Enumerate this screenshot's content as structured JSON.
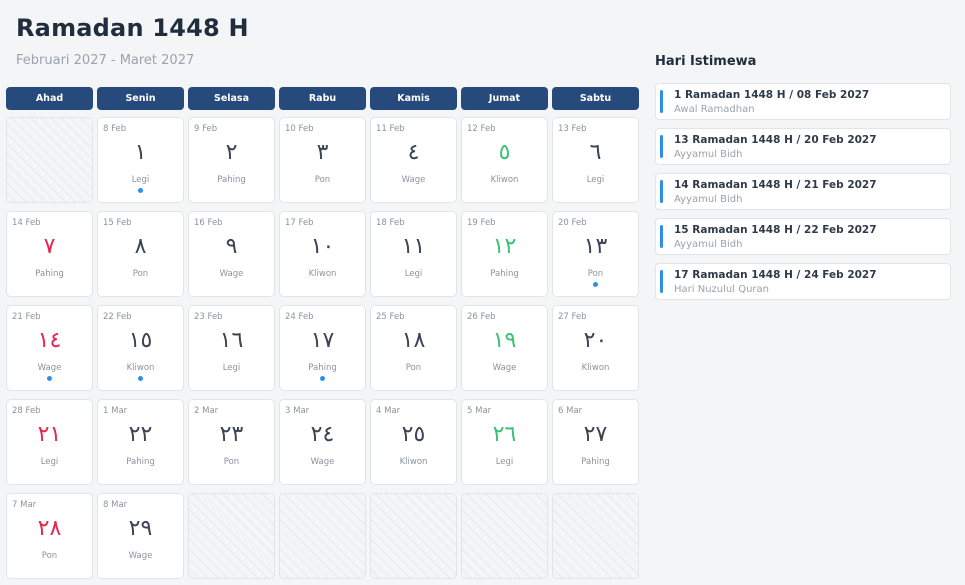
{
  "header": {
    "title": "Ramadan 1448 H",
    "subtitle": "Februari 2027 - Maret 2027"
  },
  "weekdays": [
    "Ahad",
    "Senin",
    "Selasa",
    "Rabu",
    "Kamis",
    "Jumat",
    "Sabtu"
  ],
  "calendar": {
    "days": [
      {
        "empty": true
      },
      {
        "greg": "8 Feb",
        "hijri": "١",
        "pasaran": "Legi",
        "color": "default",
        "event": true
      },
      {
        "greg": "9 Feb",
        "hijri": "٢",
        "pasaran": "Pahing",
        "color": "default",
        "event": false
      },
      {
        "greg": "10 Feb",
        "hijri": "٣",
        "pasaran": "Pon",
        "color": "default",
        "event": false
      },
      {
        "greg": "11 Feb",
        "hijri": "٤",
        "pasaran": "Wage",
        "color": "default",
        "event": false
      },
      {
        "greg": "12 Feb",
        "hijri": "٥",
        "pasaran": "Kliwon",
        "color": "green",
        "event": false
      },
      {
        "greg": "13 Feb",
        "hijri": "٦",
        "pasaran": "Legi",
        "color": "default",
        "event": false
      },
      {
        "greg": "14 Feb",
        "hijri": "٧",
        "pasaran": "Pahing",
        "color": "red",
        "event": false
      },
      {
        "greg": "15 Feb",
        "hijri": "٨",
        "pasaran": "Pon",
        "color": "default",
        "event": false
      },
      {
        "greg": "16 Feb",
        "hijri": "٩",
        "pasaran": "Wage",
        "color": "default",
        "event": false
      },
      {
        "greg": "17 Feb",
        "hijri": "١٠",
        "pasaran": "Kliwon",
        "color": "default",
        "event": false
      },
      {
        "greg": "18 Feb",
        "hijri": "١١",
        "pasaran": "Legi",
        "color": "default",
        "event": false
      },
      {
        "greg": "19 Feb",
        "hijri": "١٢",
        "pasaran": "Pahing",
        "color": "green",
        "event": false
      },
      {
        "greg": "20 Feb",
        "hijri": "١٣",
        "pasaran": "Pon",
        "color": "default",
        "event": true
      },
      {
        "greg": "21 Feb",
        "hijri": "١٤",
        "pasaran": "Wage",
        "color": "red",
        "event": true
      },
      {
        "greg": "22 Feb",
        "hijri": "١٥",
        "pasaran": "Kliwon",
        "color": "default",
        "event": true
      },
      {
        "greg": "23 Feb",
        "hijri": "١٦",
        "pasaran": "Legi",
        "color": "default",
        "event": false
      },
      {
        "greg": "24 Feb",
        "hijri": "١٧",
        "pasaran": "Pahing",
        "color": "default",
        "event": true
      },
      {
        "greg": "25 Feb",
        "hijri": "١٨",
        "pasaran": "Pon",
        "color": "default",
        "event": false
      },
      {
        "greg": "26 Feb",
        "hijri": "١٩",
        "pasaran": "Wage",
        "color": "green",
        "event": false
      },
      {
        "greg": "27 Feb",
        "hijri": "٢٠",
        "pasaran": "Kliwon",
        "color": "default",
        "event": false
      },
      {
        "greg": "28 Feb",
        "hijri": "٢١",
        "pasaran": "Legi",
        "color": "red",
        "event": false
      },
      {
        "greg": "1 Mar",
        "hijri": "٢٢",
        "pasaran": "Pahing",
        "color": "default",
        "event": false
      },
      {
        "greg": "2 Mar",
        "hijri": "٢٣",
        "pasaran": "Pon",
        "color": "default",
        "event": false
      },
      {
        "greg": "3 Mar",
        "hijri": "٢٤",
        "pasaran": "Wage",
        "color": "default",
        "event": false
      },
      {
        "greg": "4 Mar",
        "hijri": "٢٥",
        "pasaran": "Kliwon",
        "color": "default",
        "event": false
      },
      {
        "greg": "5 Mar",
        "hijri": "٢٦",
        "pasaran": "Legi",
        "color": "green",
        "event": false
      },
      {
        "greg": "6 Mar",
        "hijri": "٢٧",
        "pasaran": "Pahing",
        "color": "default",
        "event": false
      },
      {
        "greg": "7 Mar",
        "hijri": "٢٨",
        "pasaran": "Pon",
        "color": "red",
        "event": false
      },
      {
        "greg": "8 Mar",
        "hijri": "٢٩",
        "pasaran": "Wage",
        "color": "default",
        "event": false
      },
      {
        "empty": true
      },
      {
        "empty": true
      },
      {
        "empty": true
      },
      {
        "empty": true
      },
      {
        "empty": true
      }
    ]
  },
  "sidebar": {
    "title": "Hari Istimewa",
    "events": [
      {
        "date": "1 Ramadan 1448 H / 08 Feb 2027",
        "name": "Awal Ramadhan"
      },
      {
        "date": "13 Ramadan 1448 H / 20 Feb 2027",
        "name": "Ayyamul Bidh"
      },
      {
        "date": "14 Ramadan 1448 H / 21 Feb 2027",
        "name": "Ayyamul Bidh"
      },
      {
        "date": "15 Ramadan 1448 H / 22 Feb 2027",
        "name": "Ayyamul Bidh"
      },
      {
        "date": "17 Ramadan 1448 H / 24 Feb 2027",
        "name": "Hari Nuzulul Quran"
      }
    ]
  },
  "colors": {
    "weekday_header": "#264a7c",
    "sunday_red": "#e4284f",
    "friday_green": "#3cc274",
    "event_blue": "#2f8fe6"
  }
}
